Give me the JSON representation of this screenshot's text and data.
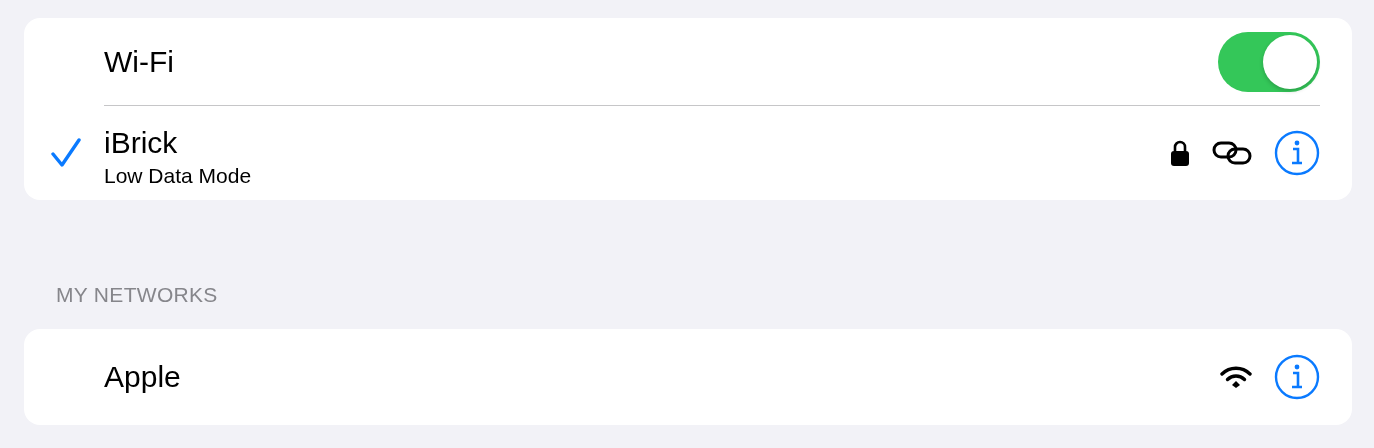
{
  "wifi": {
    "label": "Wi-Fi",
    "on": true
  },
  "current_networks": [
    {
      "name": "iBrick",
      "subtitle": "Low Data Mode",
      "selected": true,
      "status_icons": [
        {
          "kind": "lock"
        },
        {
          "kind": "link"
        }
      ]
    }
  ],
  "my_networks": {
    "header": "MY NETWORKS",
    "networks": [
      {
        "name": "Apple",
        "selected": false,
        "status_icons": [
          {
            "kind": "wifi"
          }
        ]
      }
    ]
  }
}
